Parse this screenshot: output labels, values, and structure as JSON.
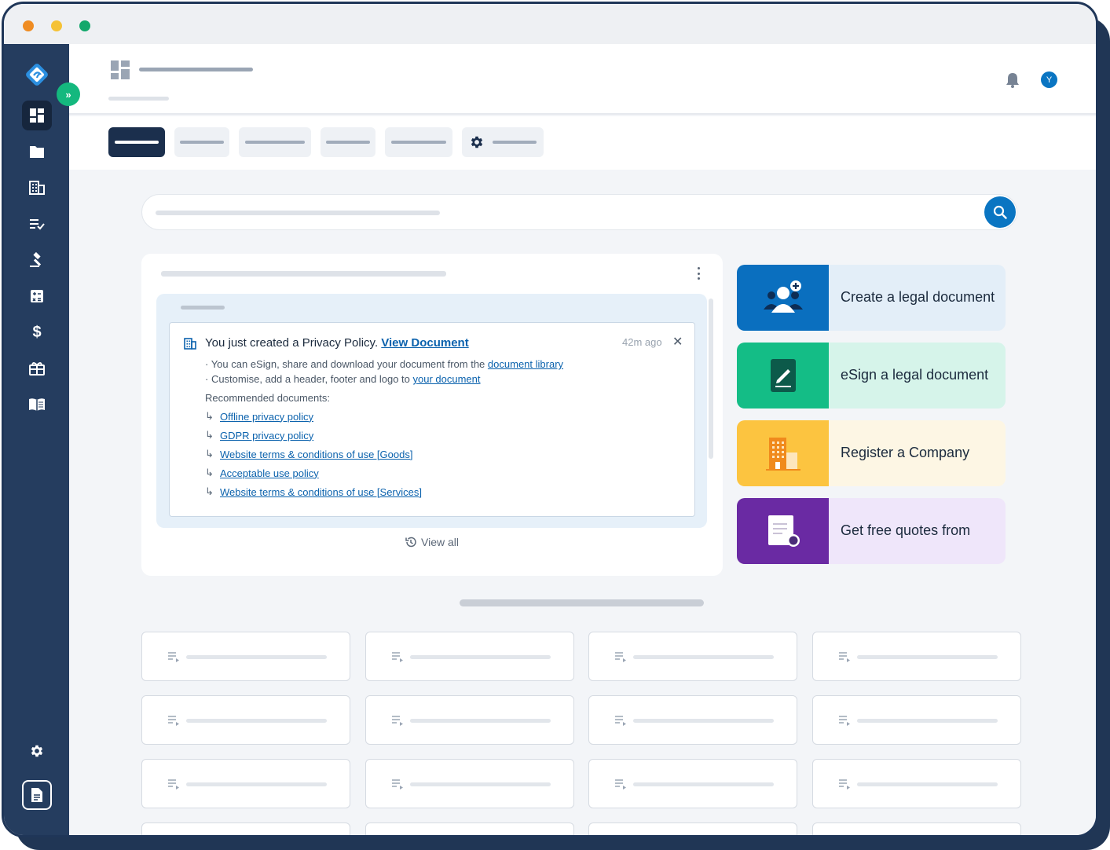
{
  "window": {
    "dot_colors": [
      "#ef8c22",
      "#f5c236",
      "#12a86b"
    ]
  },
  "sidebar": {
    "items": [
      {
        "icon": "dashboard-icon",
        "active": true
      },
      {
        "icon": "folder-icon"
      },
      {
        "icon": "company-building-icon"
      },
      {
        "icon": "checklist-icon"
      },
      {
        "icon": "gavel-icon"
      },
      {
        "icon": "calculator-icon"
      },
      {
        "icon": "dollar-icon"
      },
      {
        "icon": "gift-icon"
      },
      {
        "icon": "book-icon"
      }
    ],
    "bottom": [
      {
        "icon": "gear-icon"
      },
      {
        "icon": "document-icon"
      }
    ]
  },
  "header": {
    "avatar_initial": "Y"
  },
  "notification": {
    "title_prefix": "You just created a Privacy Policy.",
    "title_link": "View Document",
    "time": "42m ago",
    "line1_prefix": "· You can eSign, share and download your document from the",
    "line1_link": "document library",
    "line2_prefix": "· Customise, add a header, footer and logo to",
    "line2_link": "your document",
    "recommended_label": "Recommended documents:",
    "recommended": [
      "Offline privacy policy",
      "GDPR privacy policy",
      "Website terms & conditions of use [Goods]",
      "Acceptable use policy",
      "Website terms & conditions of use [Services]"
    ]
  },
  "view_all": "View all",
  "quick_actions": [
    {
      "label": "Create a legal document",
      "icon": "person-add-icon",
      "icon_bg": "#0a6fbf",
      "bg": "#e3eef8"
    },
    {
      "label": "eSign a legal document",
      "icon": "esign-pen-icon",
      "icon_bg": "#14bd86",
      "bg": "#d6f4ea"
    },
    {
      "label": "Register a Company",
      "icon": "office-building-icon",
      "icon_bg": "#fcc440",
      "bg": "#fdf6e4"
    },
    {
      "label": "Get free quotes from",
      "icon": "certificate-icon",
      "icon_bg": "#6a2aa3",
      "bg": "#efe6fa"
    }
  ],
  "colors": {
    "accent": "#0a75c2",
    "sidebar": "#253d5f",
    "link": "#0b62ad"
  }
}
